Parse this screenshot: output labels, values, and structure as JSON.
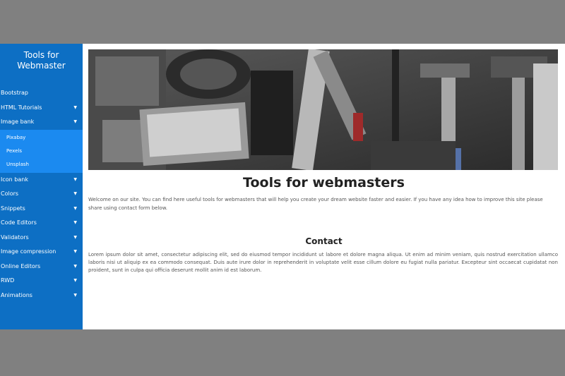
{
  "sidebar": {
    "brand": "Tools for Webmaster",
    "items": [
      {
        "label": "Bootstrap",
        "has_caret": false
      },
      {
        "label": "HTML Tutorials",
        "has_caret": true
      },
      {
        "label": "Image bank",
        "has_caret": true,
        "expanded": true
      }
    ],
    "submenu": [
      "Pixabay",
      "Pexels",
      "Unsplash"
    ],
    "items_after": [
      {
        "label": "Icon bank",
        "has_caret": true
      },
      {
        "label": "Colors",
        "has_caret": true
      },
      {
        "label": "Snippets",
        "has_caret": true
      },
      {
        "label": "Code Editors",
        "has_caret": true
      },
      {
        "label": "Validators",
        "has_caret": true
      },
      {
        "label": "Image compression",
        "has_caret": true
      },
      {
        "label": "Online Editors",
        "has_caret": true
      },
      {
        "label": "RWD",
        "has_caret": true
      },
      {
        "label": "Animations",
        "has_caret": true
      }
    ],
    "caret_glyph": "▼"
  },
  "main": {
    "hero_alt": "tools on a workbench",
    "title": "Tools for webmasters",
    "intro": "Welcome on our site. You can find here useful tools for webmasters that will help you create your dream website faster and easier. If you have any idea how to improve this site please share using contact form below.",
    "contact_title": "Contact",
    "lorem": "Lorem ipsum dolor sit amet, consectetur adipiscing elit, sed do eiusmod tempor incididunt ut labore et dolore magna aliqua. Ut enim ad minim veniam, quis nostrud exercitation ullamco laboris nisi ut aliquip ex ea commodo consequat. Duis aute irure dolor in reprehenderit in voluptate velit esse cillum dolore eu fugiat nulla pariatur. Excepteur sint occaecat cupidatat non proident, sunt in culpa qui officia deserunt mollit anim id est laborum."
  },
  "colors": {
    "sidebar": "#0d6fc4",
    "submenu": "#1b8af0",
    "backdrop": "#808080"
  }
}
